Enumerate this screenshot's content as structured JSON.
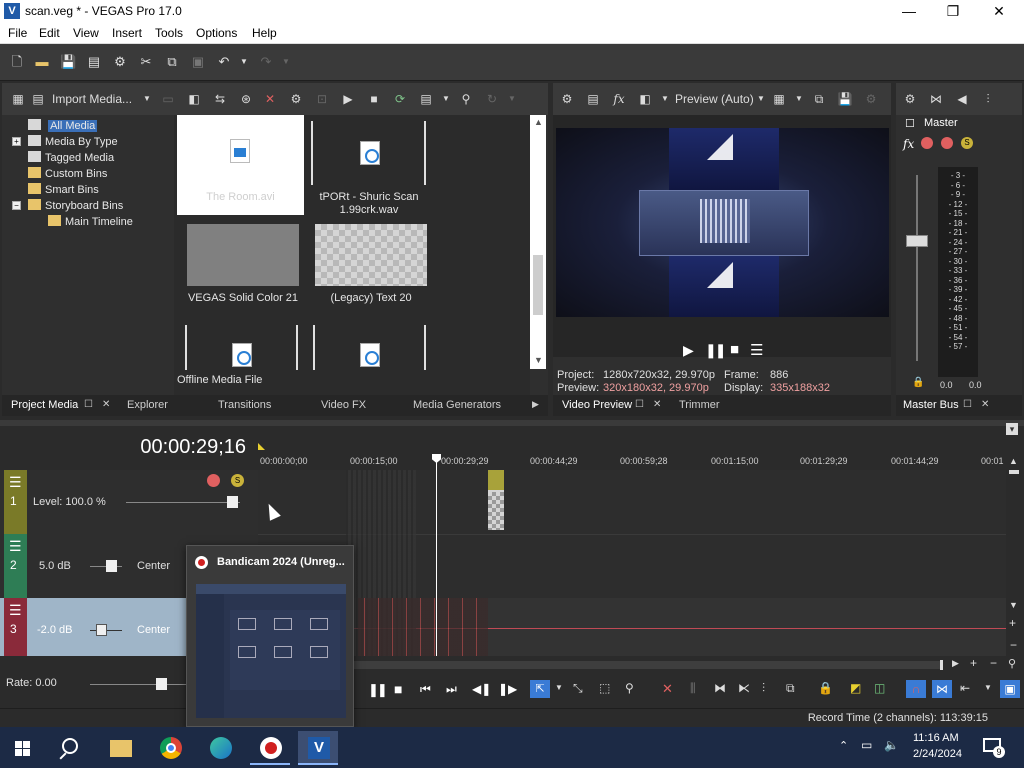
{
  "window": {
    "title": "scan.veg * - VEGAS Pro 17.0",
    "app_icon": "V"
  },
  "menu": [
    "File",
    "Edit",
    "View",
    "Insert",
    "Tools",
    "Options",
    "Help"
  ],
  "project_media": {
    "import_label": "Import Media...",
    "tree": [
      "All Media",
      "Media By Type",
      "Tagged Media",
      "Custom Bins",
      "Smart Bins",
      "Storyboard Bins",
      "Main Timeline"
    ],
    "items": [
      {
        "label": "The Room.avi"
      },
      {
        "label": "tPORt - Shuric Scan 1.99crk.wav"
      },
      {
        "label": "VEGAS Solid Color 21"
      },
      {
        "label": "(Legacy) Text 20"
      }
    ],
    "status": "Offline Media File"
  },
  "left_tabs": [
    "Project Media",
    "Explorer",
    "Transitions",
    "Video FX",
    "Media Generators"
  ],
  "preview": {
    "mode": "Preview (Auto)",
    "project_label": "Project:",
    "project_value": "1280x720x32, 29.970p",
    "frame_label": "Frame:",
    "frame_value": "886",
    "preview_label": "Preview:",
    "preview_value": "320x180x32, 29.970p",
    "display_label": "Display:",
    "display_value": "335x188x32",
    "tabs": [
      "Video Preview",
      "Trimmer"
    ]
  },
  "master": {
    "title": "Master",
    "scale": [
      "3",
      "6",
      "9",
      "12",
      "15",
      "18",
      "21",
      "24",
      "27",
      "30",
      "33",
      "36",
      "39",
      "42",
      "45",
      "48",
      "51",
      "54",
      "57"
    ],
    "left_value": "0.0",
    "right_value": "0.0",
    "tab": "Master Bus"
  },
  "timeline": {
    "timecode": "00:00:29;16",
    "ruler": [
      "00:00:00;00",
      "00:00:15;00",
      "00:00:29;29",
      "00:00:44;29",
      "00:00:59;28",
      "00:01:15;00",
      "00:01:29;29",
      "00:01:44;29",
      "00:01"
    ],
    "cursor_label": "29;29",
    "tracks": [
      {
        "num": "1",
        "label": "Level: 100.0 %"
      },
      {
        "num": "2",
        "db": "5.0 dB",
        "pan": "Center"
      },
      {
        "num": "3",
        "db": "-2.0 dB",
        "pan": "Center"
      }
    ],
    "rate": "Rate: 0.00",
    "record_time": "Record Time (2 channels): 113:39:15"
  },
  "bandicam_popup": {
    "title": "Bandicam 2024 (Unreg..."
  },
  "taskbar": {
    "time": "11:16 AM",
    "date": "2/24/2024",
    "notif_count": "9"
  },
  "colors": {
    "track1": "#7a7a28",
    "track2": "#2e7d55",
    "track3": "#8a2a3a",
    "selected_track": "#9fb5c8",
    "accent": "#3a7bd5",
    "taskbar": "#1c2a45"
  }
}
